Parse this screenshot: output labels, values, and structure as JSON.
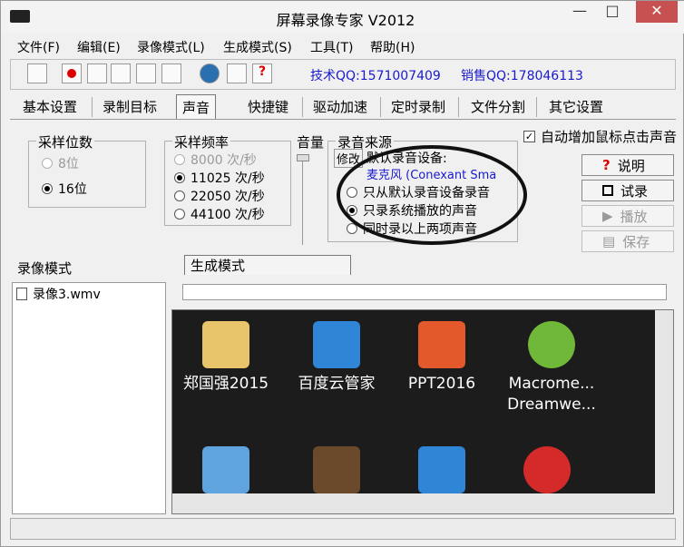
{
  "window": {
    "title": "屏幕录像专家 V2012"
  },
  "menu": [
    "文件(F)",
    "编辑(E)",
    "录像模式(L)",
    "生成模式(S)",
    "工具(T)",
    "帮助(H)"
  ],
  "toolbar": {
    "tech_qq": "技术QQ:1571007409",
    "sales_qq": "销售QQ:178046113"
  },
  "tabs": [
    "基本设置",
    "录制目标",
    "声音",
    "快捷键",
    "驱动加速",
    "定时录制",
    "文件分割",
    "其它设置"
  ],
  "sample_bits": {
    "title": "采样位数",
    "options": [
      "8位",
      "16位"
    ]
  },
  "sample_rate": {
    "title": "采样频率",
    "options": [
      "8000 次/秒",
      "11025 次/秒",
      "22050 次/秒",
      "44100 次/秒"
    ]
  },
  "volume": {
    "label": "音量"
  },
  "source": {
    "title": "录音来源",
    "setting_label": "修改",
    "default_device_label": "默认录音设备:",
    "device": "麦克风 (Conexant Sma",
    "options": [
      "只从默认录音设备录音",
      "只录系统播放的声音",
      "同时录以上两项声音"
    ]
  },
  "mouse_click_sound": {
    "label": "自动增加鼠标点击声音"
  },
  "side_buttons": {
    "help": "说明",
    "test": "试录",
    "play": "播放",
    "save": "保存"
  },
  "lower_tabs": {
    "record": "录像模式",
    "generate": "生成模式"
  },
  "file_list": [
    "录像3.wmv"
  ],
  "desktop_icons": [
    "郑国强2015",
    "百度云管家",
    "PPT2016",
    "Macrome... Dreamwe..."
  ],
  "colors": {
    "qq_text": "#1a1acc",
    "device_text": "#1a1acc",
    "close_button": "#c75050"
  }
}
